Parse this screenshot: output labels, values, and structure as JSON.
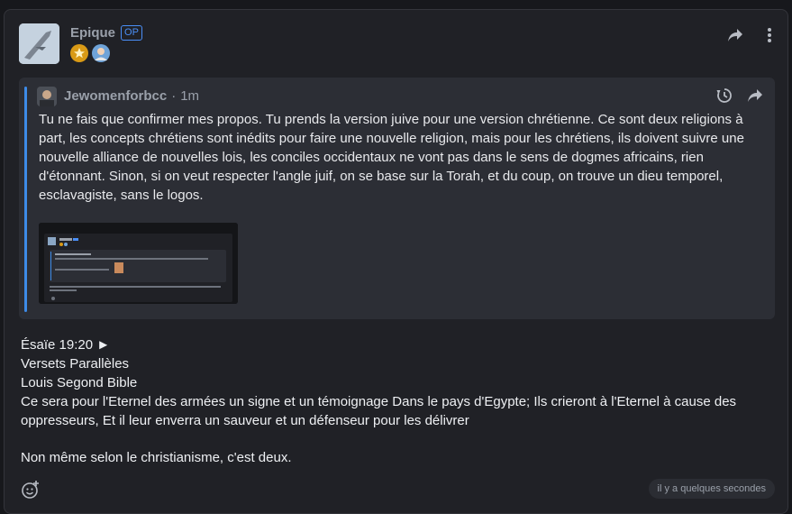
{
  "post": {
    "author": "Epique",
    "op_badge": "OP",
    "badges": [
      "star-badge",
      "avatar-badge"
    ],
    "quote": {
      "author": "Jewomenforbcc",
      "separator": "·",
      "time": "1m",
      "text": "Tu ne fais que confirmer mes propos. Tu prends la version juive pour une version chrétienne. Ce sont deux religions à part, les concepts chrétiens sont inédits pour faire une nouvelle religion, mais pour les chrétiens, ils doivent suivre une nouvelle alliance de nouvelles lois, les conciles occidentaux ne vont pas dans le sens de dogmes africains, rien d'étonnant. Sinon, si on veut respecter l'angle juif, on se base sur la Torah, et du coup, on trouve un dieu temporel, esclavagiste, sans le logos."
    },
    "lines": [
      "Ésaïe 19:20 ►",
      "Versets Parallèles",
      "Louis Segond Bible",
      "Ce sera pour l'Eternel des armées un signe et un témoignage Dans le pays d'Egypte; Ils crieront à l'Eternel à cause des oppresseurs, Et il leur enverra un sauveur et un défenseur pour les délivrer"
    ],
    "closing": "Non même selon le christianisme, c'est deux.",
    "timestamp": "il y a quelques secondes"
  },
  "colors": {
    "accent": "#3d8be8",
    "background": "#202126",
    "quote_bg": "#2c2e35"
  }
}
